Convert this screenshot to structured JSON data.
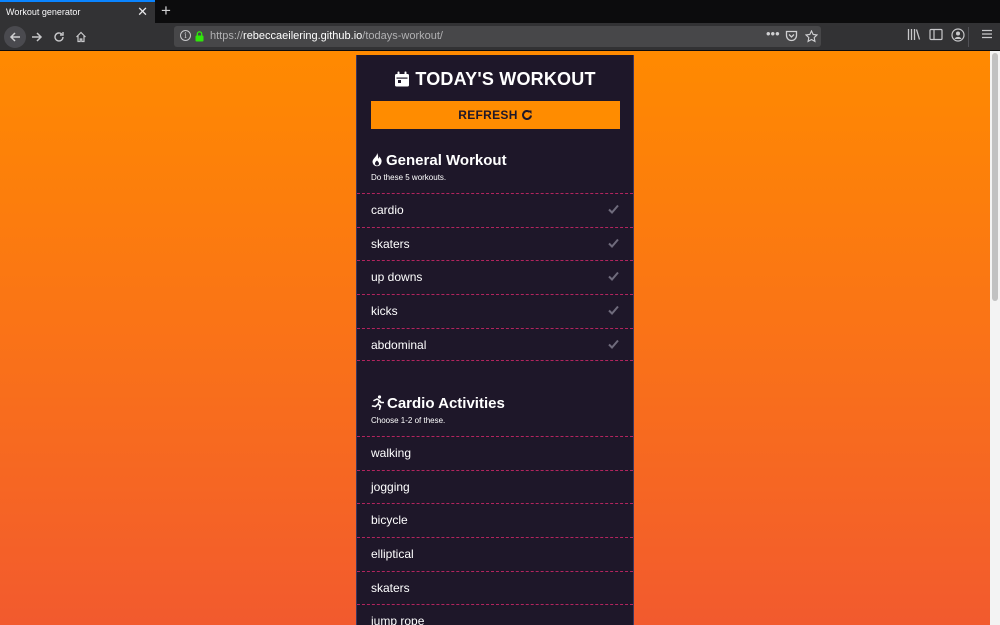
{
  "browser": {
    "tab_title": "Workout generator",
    "tab_close": "✕",
    "new_tab": "+",
    "url_scheme": "https://",
    "url_host": "rebeccaeilering.github.io",
    "url_path": "/todays-workout/",
    "url_more": "•••"
  },
  "page": {
    "title": "TODAY'S WORKOUT",
    "refresh_label": "REFRESH",
    "accent_color": "#ff8c00",
    "panel_color": "#1e1729",
    "divider_color": "#b3245e"
  },
  "general": {
    "title": "General Workout",
    "subtitle": "Do these 5 workouts.",
    "icon": "flame-icon",
    "items": [
      "cardio",
      "skaters",
      "up downs",
      "kicks",
      "abdominal"
    ]
  },
  "cardio": {
    "title": "Cardio Activities",
    "subtitle": "Choose 1-2 of these.",
    "icon": "running-icon",
    "items": [
      "walking",
      "jogging",
      "bicycle",
      "elliptical",
      "skaters",
      "jump rope"
    ]
  }
}
